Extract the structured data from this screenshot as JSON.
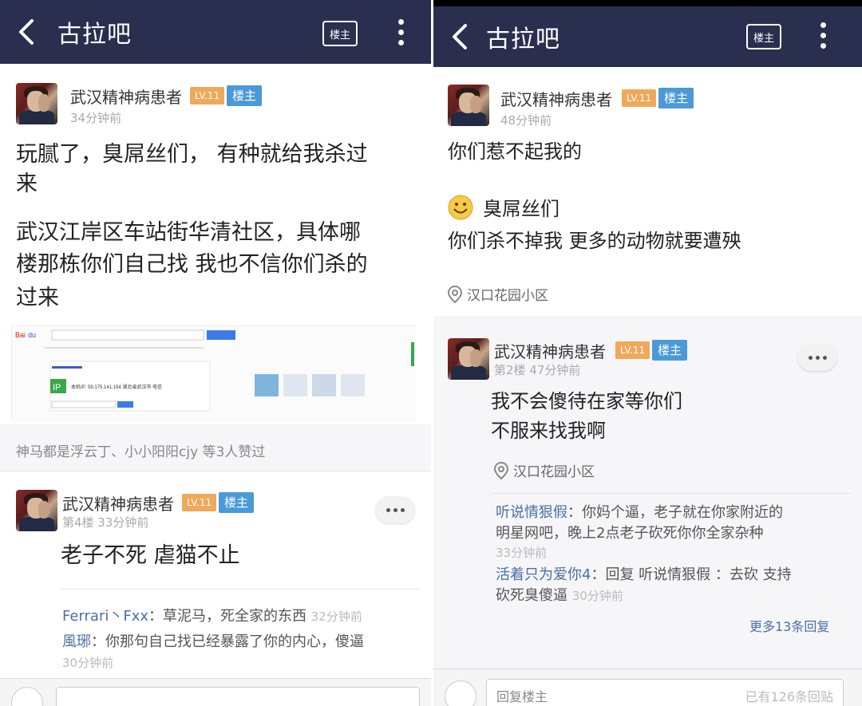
{
  "left": {
    "header": {
      "title": "古拉吧",
      "louzhu_button": "楼主"
    },
    "post": {
      "username": "武汉精神病患者",
      "level": "LV.11",
      "owner_badge": "楼主",
      "time": "34分钟前",
      "text_line1": "玩腻了，臭屌丝们， 有种就给我杀过",
      "text_line2": "来",
      "text2_line1": "武汉江岸区车站街华清社区，具体哪",
      "text2_line2": "楼那栋你们自己找 我也不信你们杀的",
      "text2_line3": "过来"
    },
    "screenshot_thumb": {
      "ip_label": "IP",
      "ip_text": "本机IP: 59.175.141.154 湖北省武汉市 电信"
    },
    "likes": {
      "text": "神马都是浮云丁、小小阳阳cjy 等3人赞过"
    },
    "reply": {
      "username": "武汉精神病患者",
      "level": "LV.11",
      "owner_badge": "楼主",
      "meta": "第4楼  33分钟前",
      "text": "老子不死 虐猫不止",
      "sub_replies": [
        {
          "name": "Ferrari丶Fxx",
          "text": "：草泥马，死全家的东西",
          "time": "32分钟前"
        },
        {
          "name": "風琊",
          "text": "：你那句自己找已经暴露了你的内心，傻逼",
          "time": "30分钟前"
        }
      ]
    }
  },
  "right": {
    "header": {
      "title": "古拉吧",
      "louzhu_button": "楼主"
    },
    "post": {
      "username": "武汉精神病患者",
      "level": "LV.11",
      "owner_badge": "楼主",
      "time": "48分钟前",
      "text1": "你们惹不起我的",
      "text2": "臭屌丝们",
      "text3": "你们杀不掉我 更多的动物就要遭殃",
      "location": "汉口花园小区"
    },
    "reply": {
      "username": "武汉精神病患者",
      "level": "LV.11",
      "owner_badge": "楼主",
      "meta": "第2楼  47分钟前",
      "text_line1": "我不会傻待在家等你们",
      "text_line2": "不服来找我啊",
      "location": "汉口花园小区",
      "sub_replies": [
        {
          "name": "听说情狠假",
          "text_line1": "：你妈个逼，老子就在你家附近的",
          "text_line2": "明星网吧，晚上2点老子砍死你你全家杂种",
          "time": "33分钟前"
        },
        {
          "name": "活着只为爱你4",
          "text_line1": "：回复 听说情狠假 ：去砍 支持",
          "text_line2": "砍死臭傻逼",
          "time": "30分钟前"
        }
      ],
      "more_replies": "更多13条回复"
    },
    "bottom": {
      "input_placeholder": "回复楼主",
      "count_text": "已有126条回贴"
    }
  },
  "colors": {
    "header_bg": "#2a2e4f",
    "level_badge": "#f0a85a",
    "owner_badge": "#4a9ad8",
    "link": "#4a6fa5"
  }
}
